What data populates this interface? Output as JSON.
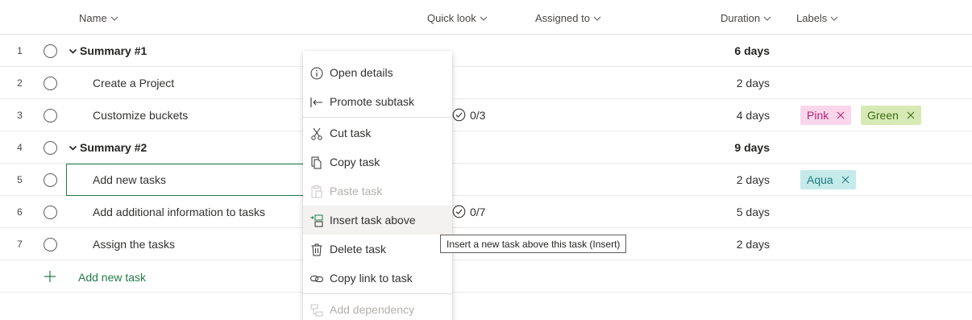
{
  "header": {
    "name": "Name",
    "quick_look": "Quick look",
    "assigned_to": "Assigned to",
    "duration": "Duration",
    "labels": "Labels"
  },
  "rows": [
    {
      "num": "1",
      "name": "Summary #1",
      "duration": "6 days"
    },
    {
      "num": "2",
      "name": "Create a Project",
      "duration": "2 days"
    },
    {
      "num": "3",
      "name": "Customize buckets",
      "duration": "4 days",
      "quick": "0/3"
    },
    {
      "num": "4",
      "name": "Summary #2",
      "duration": "9 days"
    },
    {
      "num": "5",
      "name": "Add new tasks",
      "duration": "2 days"
    },
    {
      "num": "6",
      "name": "Add additional information to tasks",
      "duration": "5 days",
      "quick": "0/7"
    },
    {
      "num": "7",
      "name": "Assign the tasks",
      "duration": "2 days"
    }
  ],
  "labels": {
    "pink": {
      "text": "Pink",
      "bg": "#f9d6eb",
      "fg": "#b4246f"
    },
    "green": {
      "text": "Green",
      "bg": "#d7eab5",
      "fg": "#3f6b0f"
    },
    "aqua": {
      "text": "Aqua",
      "bg": "#c5eaea",
      "fg": "#1f7a7f"
    }
  },
  "add_task": "Add new task",
  "menu": {
    "open_details": "Open details",
    "promote_subtask": "Promote subtask",
    "cut_task": "Cut task",
    "copy_task": "Copy task",
    "paste_task": "Paste task",
    "insert_task_above": "Insert task above",
    "delete_task": "Delete task",
    "copy_link": "Copy link to task",
    "add_dependency": "Add dependency"
  },
  "tooltip": "Insert a new task above this task (Insert)",
  "colors": {
    "accent": "#237b4b",
    "hover": "#f3f2f1"
  }
}
